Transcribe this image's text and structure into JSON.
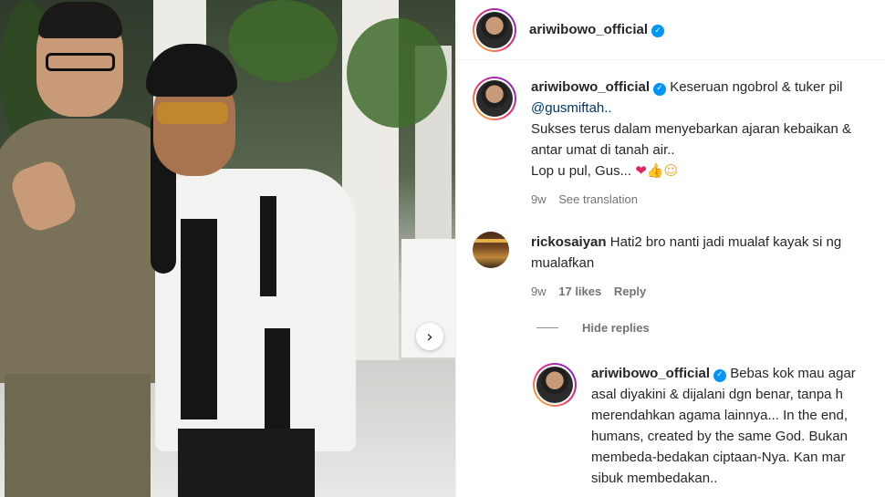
{
  "post": {
    "author": "ariwibowo_official",
    "carousel_next_icon": "›"
  },
  "caption": {
    "username": "ariwibowo_official",
    "line1": "Keseruan ngobrol & tuker pil",
    "mention": "@gusmiftah..",
    "line3": "Sukses terus dalam menyebarkan ajaran kebaikan &",
    "line4": "antar umat di tanah air..",
    "line5": "Lop u pul, Gus...",
    "emoji_heart": "❤",
    "emoji_thumbs": "👍",
    "emoji_smile": "☺",
    "time": "9w",
    "see_translation": "See translation"
  },
  "comment": {
    "username": "rickosaiyan",
    "line1": "Hati2 bro nanti jadi mualaf kayak si ng",
    "line2": "mualafkan",
    "time": "9w",
    "likes": "17 likes",
    "reply": "Reply"
  },
  "hide_replies": "Hide replies",
  "reply": {
    "username": "ariwibowo_official",
    "line1": "Bebas kok mau agar",
    "line2": "asal diyakini & dijalani dgn benar, tanpa h",
    "line3": "merendahkan agama lainnya... In the end,",
    "line4": "humans, created by the same God. Bukan",
    "line5": "membeda-bedakan ciptaan-Nya. Kan mar",
    "line6": "sibuk membedakan.."
  },
  "colors": {
    "verified": "#0095f6",
    "mention": "#00376b",
    "muted": "#737373"
  }
}
